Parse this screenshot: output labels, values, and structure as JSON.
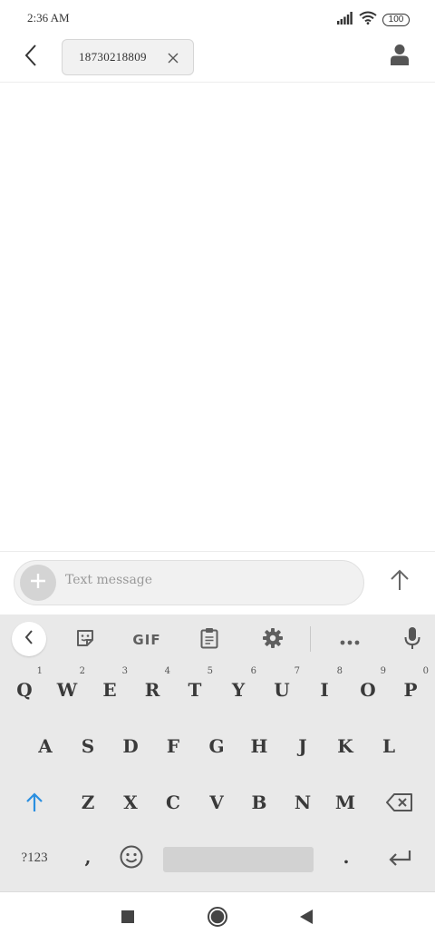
{
  "status_bar": {
    "time": "2:36 AM",
    "battery": "100",
    "icons": [
      "signal-icon",
      "wifi-icon",
      "battery-icon"
    ]
  },
  "header": {
    "recipient": "18730218809",
    "back_icon": "chevron-left-icon",
    "remove_icon": "close-icon",
    "contact_icon": "person-icon"
  },
  "compose": {
    "placeholder": "Text message",
    "value": "",
    "attach_icon": "plus-icon",
    "send_icon": "arrow-up-icon"
  },
  "keyboard": {
    "toolbar": {
      "collapse_icon": "chevron-left-icon",
      "sticker_icon": "sticker-icon",
      "gif_label": "GIF",
      "clipboard_icon": "clipboard-icon",
      "settings_icon": "gear-icon",
      "more_icon": "more-dots-icon",
      "mic_icon": "microphone-icon"
    },
    "row1": [
      {
        "key": "Q",
        "hint": "1"
      },
      {
        "key": "W",
        "hint": "2"
      },
      {
        "key": "E",
        "hint": "3"
      },
      {
        "key": "R",
        "hint": "4"
      },
      {
        "key": "T",
        "hint": "5"
      },
      {
        "key": "Y",
        "hint": "6"
      },
      {
        "key": "U",
        "hint": "7"
      },
      {
        "key": "I",
        "hint": "8"
      },
      {
        "key": "O",
        "hint": "9"
      },
      {
        "key": "P",
        "hint": "0"
      }
    ],
    "row2": [
      "A",
      "S",
      "D",
      "F",
      "G",
      "H",
      "J",
      "K",
      "L"
    ],
    "row3": [
      "Z",
      "X",
      "C",
      "V",
      "B",
      "N",
      "M"
    ],
    "shift_icon": "shift-arrow-icon",
    "backspace_icon": "backspace-icon",
    "symbols_label": "?123",
    "comma_label": ",",
    "emoji_icon": "emoji-icon",
    "period_label": ".",
    "enter_icon": "enter-icon",
    "accent_color": "#2a8fe0"
  },
  "nav_bar": {
    "recents_icon": "square-icon",
    "home_icon": "circle-icon",
    "back_icon": "triangle-back-icon"
  }
}
